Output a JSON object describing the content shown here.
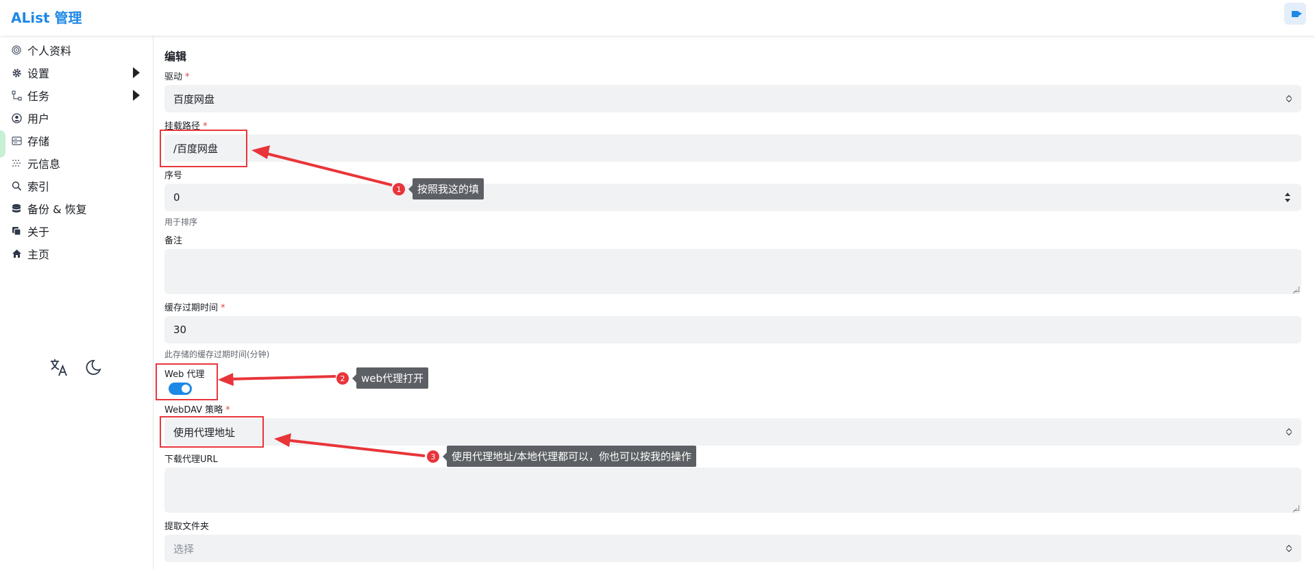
{
  "header": {
    "brand": "AList 管理",
    "logout_icon": "logout-icon"
  },
  "sidebar": {
    "items": [
      {
        "label": "个人资料",
        "icon": "fingerprint-icon",
        "expandable": false
      },
      {
        "label": "设置",
        "icon": "gear-icon",
        "expandable": true
      },
      {
        "label": "任务",
        "icon": "task-icon",
        "expandable": true
      },
      {
        "label": "用户",
        "icon": "user-icon",
        "expandable": false
      },
      {
        "label": "存储",
        "icon": "storage-icon",
        "expandable": false
      },
      {
        "label": "元信息",
        "icon": "meta-icon",
        "expandable": false
      },
      {
        "label": "索引",
        "icon": "search-icon",
        "expandable": false
      },
      {
        "label": "备份 & 恢复",
        "icon": "database-icon",
        "expandable": false
      },
      {
        "label": "关于",
        "icon": "copy-icon",
        "expandable": false
      },
      {
        "label": "主页",
        "icon": "home-icon",
        "expandable": false
      }
    ],
    "tools": {
      "translate_icon": "translate-icon",
      "theme_icon": "moon-icon"
    }
  },
  "form": {
    "title": "编辑",
    "driver": {
      "label": "驱动",
      "value": "百度网盘"
    },
    "mount_path": {
      "label": "挂载路径",
      "value": "/百度网盘"
    },
    "order": {
      "label": "序号",
      "value": "0",
      "helper": "用于排序"
    },
    "remark": {
      "label": "备注",
      "value": ""
    },
    "cache_expiration": {
      "label": "缓存过期时间",
      "value": "30",
      "helper": "此存储的缓存过期时间(分钟)"
    },
    "web_proxy": {
      "label": "Web 代理",
      "enabled": true
    },
    "webdav_policy": {
      "label": "WebDAV 策略",
      "value": "使用代理地址"
    },
    "download_proxy_url": {
      "label": "下载代理URL",
      "value": ""
    },
    "extract_folder": {
      "label": "提取文件夹",
      "placeholder": "选择"
    }
  },
  "annotations": [
    {
      "number": "1",
      "text": "按照我这的填"
    },
    {
      "number": "2",
      "text": "web代理打开"
    },
    {
      "number": "3",
      "text": "使用代理地址/本地代理都可以，你也可以按我的操作"
    }
  ],
  "colors": {
    "accent": "#1e88e5",
    "annotation_red": "#e8353a",
    "field_bg": "#f1f2f4"
  }
}
